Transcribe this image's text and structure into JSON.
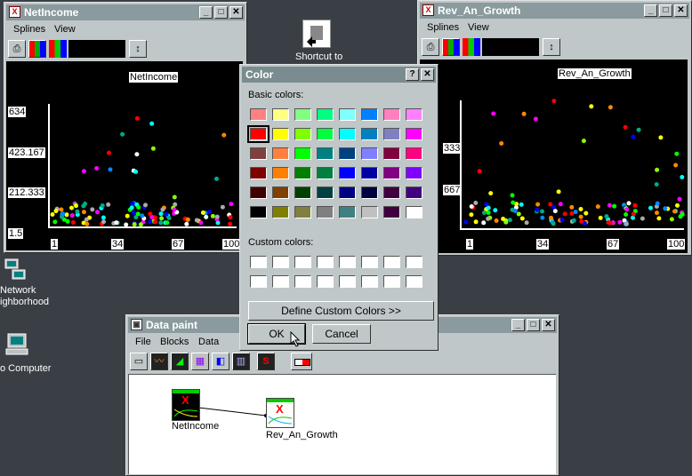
{
  "desktop": {
    "shortcut_label": "Shortcut to",
    "network_label_1": "Network",
    "network_label_2": "ighborhood",
    "computer_label": "o Computer"
  },
  "netincome_window": {
    "title": "NetIncome",
    "menus": [
      "Splines",
      "View"
    ],
    "plot_title": "NetIncome",
    "y_ticks": [
      "634",
      "423.167",
      "212.333",
      "1.5"
    ],
    "x_ticks": [
      "1",
      "34",
      "67",
      "100"
    ]
  },
  "growth_window": {
    "title": "Rev_An_Growth",
    "menus": [
      "Splines",
      "View"
    ],
    "plot_title": "Rev_An_Growth",
    "y_ticks": [
      "333",
      "667"
    ],
    "x_ticks": [
      "1",
      "34",
      "67",
      "100"
    ]
  },
  "color_dialog": {
    "title": "Color",
    "help_btn": "?",
    "close_btn": "✕",
    "basic_colors_label": "Basic colors:",
    "custom_colors_label": "Custom colors:",
    "define_custom_btn": "Define Custom Colors >>",
    "ok_btn": "OK",
    "cancel_btn": "Cancel",
    "basic_colors": [
      "#ff8080",
      "#ffff80",
      "#80ff80",
      "#00ff80",
      "#80ffff",
      "#0080ff",
      "#ff80c0",
      "#ff80ff",
      "#ff0000",
      "#ffff00",
      "#80ff00",
      "#00ff40",
      "#00ffff",
      "#0080c0",
      "#8080c0",
      "#ff00ff",
      "#804040",
      "#ff8040",
      "#00ff00",
      "#008080",
      "#004080",
      "#8080ff",
      "#800040",
      "#ff0080",
      "#800000",
      "#ff8000",
      "#008000",
      "#008040",
      "#0000ff",
      "#0000a0",
      "#800080",
      "#8000ff",
      "#400000",
      "#804000",
      "#004000",
      "#004040",
      "#000080",
      "#000040",
      "#400040",
      "#400080",
      "#000000",
      "#808000",
      "#808040",
      "#808080",
      "#408080",
      "#c0c0c0",
      "#400040",
      "#ffffff"
    ]
  },
  "datapaint_window": {
    "title": "Data paint",
    "menus": [
      "File",
      "Blocks",
      "Data"
    ],
    "node_netincome": "NetIncome",
    "node_growth": "Rev_An_Growth"
  },
  "colors": {
    "desktop": "#3a3f45",
    "window_face": "#c0c7c8",
    "title_inactive": "#8a9a9e",
    "title_active": "#7a8c90",
    "selected_swatch": "#ff0000"
  }
}
